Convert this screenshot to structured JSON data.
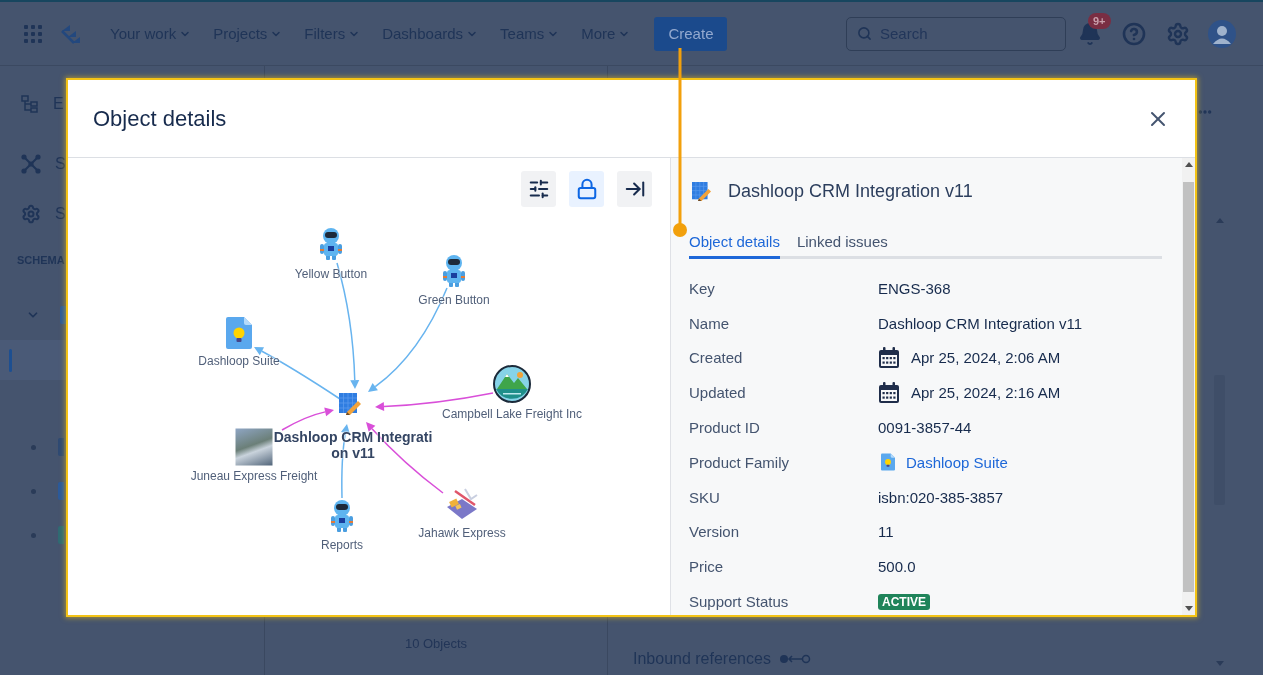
{
  "top_nav": {
    "items": [
      {
        "label": "Your work"
      },
      {
        "label": "Projects"
      },
      {
        "label": "Filters"
      },
      {
        "label": "Dashboards"
      },
      {
        "label": "Teams"
      },
      {
        "label": "More"
      }
    ],
    "create_button": "Create",
    "search": {
      "placeholder": "Search"
    },
    "notification_count": "9+"
  },
  "sidebar": {
    "items": [
      {
        "label": "E"
      },
      {
        "label": "S"
      },
      {
        "label": "S"
      }
    ],
    "section_heading": "SCHEMA"
  },
  "object_list": {
    "count": "10 Objects"
  },
  "object_panel": {
    "section_heading": "Inbound references"
  },
  "dialog": {
    "title": "Object details",
    "graph": {
      "toolbar": [
        {
          "selected": false
        },
        {
          "selected": true
        },
        {
          "selected": false
        }
      ],
      "center": {
        "label_lines": [
          "Dashloop CRM Integrati",
          "on v11"
        ]
      },
      "nodes": [
        {
          "label": "Yellow Button",
          "link": {
            "inbound": true,
            "color": "#68b4ef"
          }
        },
        {
          "label": "Green Button",
          "link": {
            "inbound": true,
            "color": "#68b4ef"
          }
        },
        {
          "label": "Dashloop Suite",
          "link": {
            "inbound": false,
            "color": "#68b4ef"
          }
        },
        {
          "label": "Campbell Lake Freight Inc",
          "link": {
            "inbound": true,
            "color": "#d94fd9"
          }
        },
        {
          "label": "Juneau Express Freight",
          "link": {
            "inbound": true,
            "color": "#d94fd9"
          }
        },
        {
          "label": "Reports",
          "link": {
            "inbound": true,
            "color": "#68b4ef"
          }
        },
        {
          "label": "Jahawk Express",
          "link": {
            "inbound": true,
            "color": "#d94fd9"
          }
        }
      ]
    },
    "details": {
      "title": "Dashloop CRM Integration v11",
      "tabs": [
        {
          "label": "Object details",
          "selected": true
        },
        {
          "label": "Linked issues",
          "selected": false
        }
      ],
      "rows": [
        {
          "kind": "text",
          "label": "Key",
          "value": "ENGS-368"
        },
        {
          "kind": "text",
          "label": "Name",
          "value": "Dashloop CRM Integration v11"
        },
        {
          "kind": "date",
          "label": "Created",
          "value": "Apr 25, 2024, 2:06 AM"
        },
        {
          "kind": "date",
          "label": "Updated",
          "value": "Apr 25, 2024, 2:16 AM"
        },
        {
          "kind": "text",
          "label": "Product ID",
          "value": "0091-3857-44"
        },
        {
          "kind": "reference",
          "label": "Product Family",
          "value": "Dashloop Suite"
        },
        {
          "kind": "text",
          "label": "SKU",
          "value": "isbn:020-385-3857"
        },
        {
          "kind": "text",
          "label": "Version",
          "value": "11"
        },
        {
          "kind": "text",
          "label": "Price",
          "value": "500.0"
        },
        {
          "kind": "status",
          "label": "Support Status",
          "value": "ACTIVE"
        }
      ]
    }
  }
}
